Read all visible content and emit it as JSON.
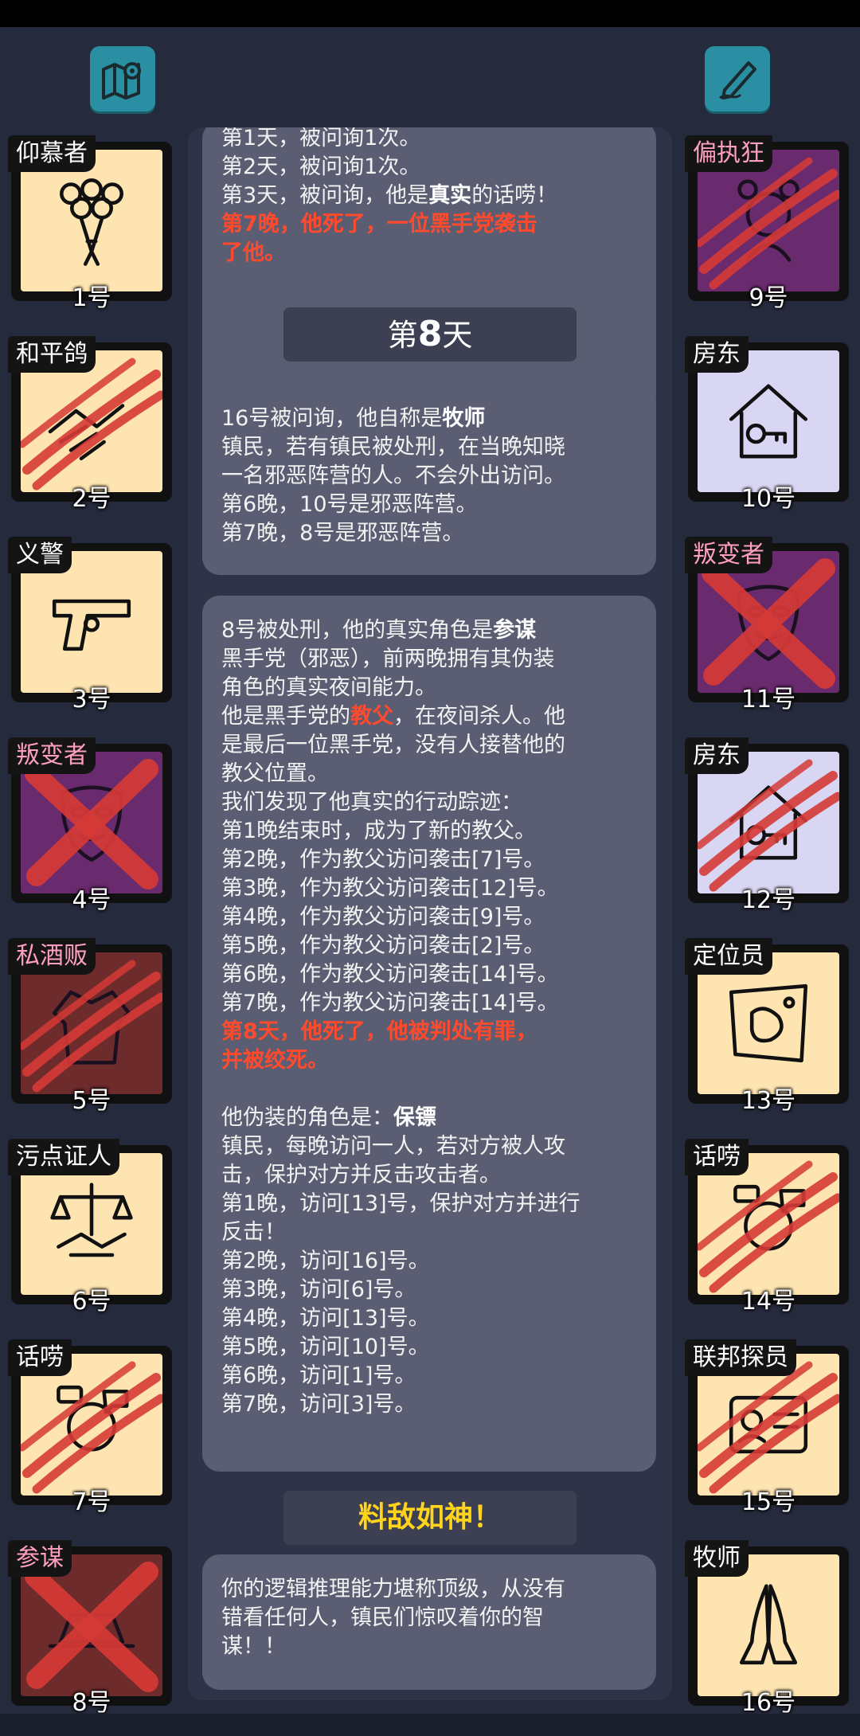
{
  "header": {
    "map_icon": "map-pin-icon",
    "edit_icon": "pencil-note-icon"
  },
  "left_players": [
    {
      "role": "仰慕者",
      "number": "1号",
      "bg": "cream",
      "icon": "bouquet-icon",
      "mark": "none",
      "pink": false
    },
    {
      "role": "和平鸽",
      "number": "2号",
      "bg": "cream",
      "icon": "handshake-icon",
      "mark": "claw",
      "pink": false
    },
    {
      "role": "义警",
      "number": "3号",
      "bg": "cream",
      "icon": "pistol-icon",
      "mark": "none",
      "pink": false
    },
    {
      "role": "叛变者",
      "number": "4号",
      "bg": "purple",
      "icon": "mask-icon",
      "mark": "x",
      "pink": true
    },
    {
      "role": "私酒贩",
      "number": "5号",
      "bg": "darkred",
      "icon": "coat-icon",
      "mark": "claw",
      "pink": true
    },
    {
      "role": "污点证人",
      "number": "6号",
      "bg": "cream",
      "icon": "scales-handshake-icon",
      "mark": "none",
      "pink": false
    },
    {
      "role": "话唠",
      "number": "7号",
      "bg": "cream",
      "icon": "chatter-icon",
      "mark": "claw",
      "pink": false
    },
    {
      "role": "参谋",
      "number": "8号",
      "bg": "darkred",
      "icon": "hat-icon",
      "mark": "x",
      "pink": true
    }
  ],
  "right_players": [
    {
      "role": "偏执狂",
      "number": "9号",
      "bg": "purple",
      "icon": "paranoid-icon",
      "mark": "claw",
      "pink": true
    },
    {
      "role": "房东",
      "number": "10号",
      "bg": "lavender",
      "icon": "house-key-icon",
      "mark": "none",
      "pink": false
    },
    {
      "role": "叛变者",
      "number": "11号",
      "bg": "purple",
      "icon": "mask-icon",
      "mark": "x",
      "pink": true
    },
    {
      "role": "房东",
      "number": "12号",
      "bg": "lavender",
      "icon": "house-key-icon",
      "mark": "claw",
      "pink": false
    },
    {
      "role": "定位员",
      "number": "13号",
      "bg": "cream",
      "icon": "map-icon",
      "mark": "none",
      "pink": false
    },
    {
      "role": "话唠",
      "number": "14号",
      "bg": "cream",
      "icon": "chatter-icon",
      "mark": "claw",
      "pink": false
    },
    {
      "role": "联邦探员",
      "number": "15号",
      "bg": "cream",
      "icon": "fbi-badge-icon",
      "mark": "claw",
      "pink": false
    },
    {
      "role": "牧师",
      "number": "16号",
      "bg": "cream",
      "icon": "praying-hands-icon",
      "mark": "none",
      "pink": false
    }
  ],
  "feed": {
    "msg1": {
      "line0": "第1天，被问询1次。",
      "line1": "第2天，被问询1次。",
      "line2_a": "第3天，被问询，他是",
      "line2_b": "真实",
      "line2_c": "的话唠！",
      "line3": "第7晚，他死了，一位黑手党袭击",
      "line4": "了他。"
    },
    "day8": {
      "prefix": "第",
      "num": "8",
      "suffix": "天"
    },
    "msg2": {
      "line1_a": "16号被问询，他自称是",
      "line1_b": "牧师",
      "line2": "镇民，若有镇民被处刑，在当晚知晓",
      "line3": "一名邪恶阵营的人。不会外出访问。",
      "line4": "第6晚，10号是邪恶阵营。",
      "line5": "第7晚，8号是邪恶阵营。"
    },
    "msg3": {
      "line1_a": "8号被处刑，他的真实角色是",
      "line1_b": "参谋",
      "line2": "黑手党（邪恶），前两晚拥有其伪装",
      "line3": "角色的真实夜间能力。",
      "line4_a": "他是黑手党的",
      "line4_b": "教父",
      "line4_c": "，在夜间杀人。他",
      "line5": "是最后一位黑手党，没有人接替他的",
      "line6": "教父位置。",
      "line7": "我们发现了他真实的行动踪迹：",
      "line8": "第1晚结束时，成为了新的教父。",
      "line9": "第2晚，作为教父访问袭击[7]号。",
      "line10": "第3晚，作为教父访问袭击[12]号。",
      "line11": "第4晚，作为教父访问袭击[9]号。",
      "line12": "第5晚，作为教父访问袭击[2]号。",
      "line13": "第6晚，作为教父访问袭击[14]号。",
      "line14": "第7晚，作为教父访问袭击[14]号。",
      "line15": "第8天，他死了，他被判处有罪，",
      "line16": "并被绞死。",
      "line17_a": "他伪装的角色是：",
      "line17_b": "保镖",
      "line18": "镇民，每晚访问一人，若对方被人攻",
      "line19": "击，保护对方并反击攻击者。",
      "line20": "第1晚，访问[13]号，保护对方并进行",
      "line21": "反击！",
      "line22": "第2晚，访问[16]号。",
      "line23": "第3晚，访问[6]号。",
      "line24": "第4晚，访问[13]号。",
      "line25": "第5晚，访问[10]号。",
      "line26": "第6晚，访问[1]号。",
      "line27": "第7晚，访问[3]号。"
    },
    "achievement": "料敌如神！",
    "msg4": {
      "line1": "你的逻辑推理能力堪称顶级，从没有",
      "line2": "错看任何人，镇民们惊叹着你的智",
      "line3": "谋！！"
    }
  },
  "colors": {
    "accent": "#2a8fa3",
    "kill_text": "#ff4a2e",
    "gold": "#ffd41a",
    "panel": "#5b5e72"
  }
}
